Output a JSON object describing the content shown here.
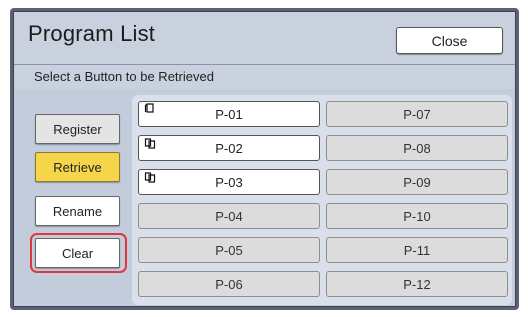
{
  "window": {
    "title": "Program List"
  },
  "header": {
    "close_label": "Close"
  },
  "instruction": "Select a Button to be Retrieved",
  "side_buttons": [
    {
      "label": "Register",
      "state": "normal"
    },
    {
      "label": "Retrieve",
      "state": "selected"
    },
    {
      "label": "Rename",
      "state": "active"
    },
    {
      "label": "Clear",
      "state": "highlighted"
    }
  ],
  "programs": [
    {
      "label": "P-01",
      "registered": true,
      "icon": "single-document-icon"
    },
    {
      "label": "P-02",
      "registered": true,
      "icon": "multi-document-icon"
    },
    {
      "label": "P-03",
      "registered": true,
      "icon": "multi-document-icon"
    },
    {
      "label": "P-04",
      "registered": false
    },
    {
      "label": "P-05",
      "registered": false
    },
    {
      "label": "P-06",
      "registered": false
    },
    {
      "label": "P-07",
      "registered": false
    },
    {
      "label": "P-08",
      "registered": false
    },
    {
      "label": "P-09",
      "registered": false
    },
    {
      "label": "P-10",
      "registered": false
    },
    {
      "label": "P-11",
      "registered": false
    },
    {
      "label": "P-12",
      "registered": false
    }
  ],
  "colors": {
    "selected_button": "#f7d54a",
    "highlight_ring": "#e0373d",
    "panel_bg": "#c9d1df"
  }
}
